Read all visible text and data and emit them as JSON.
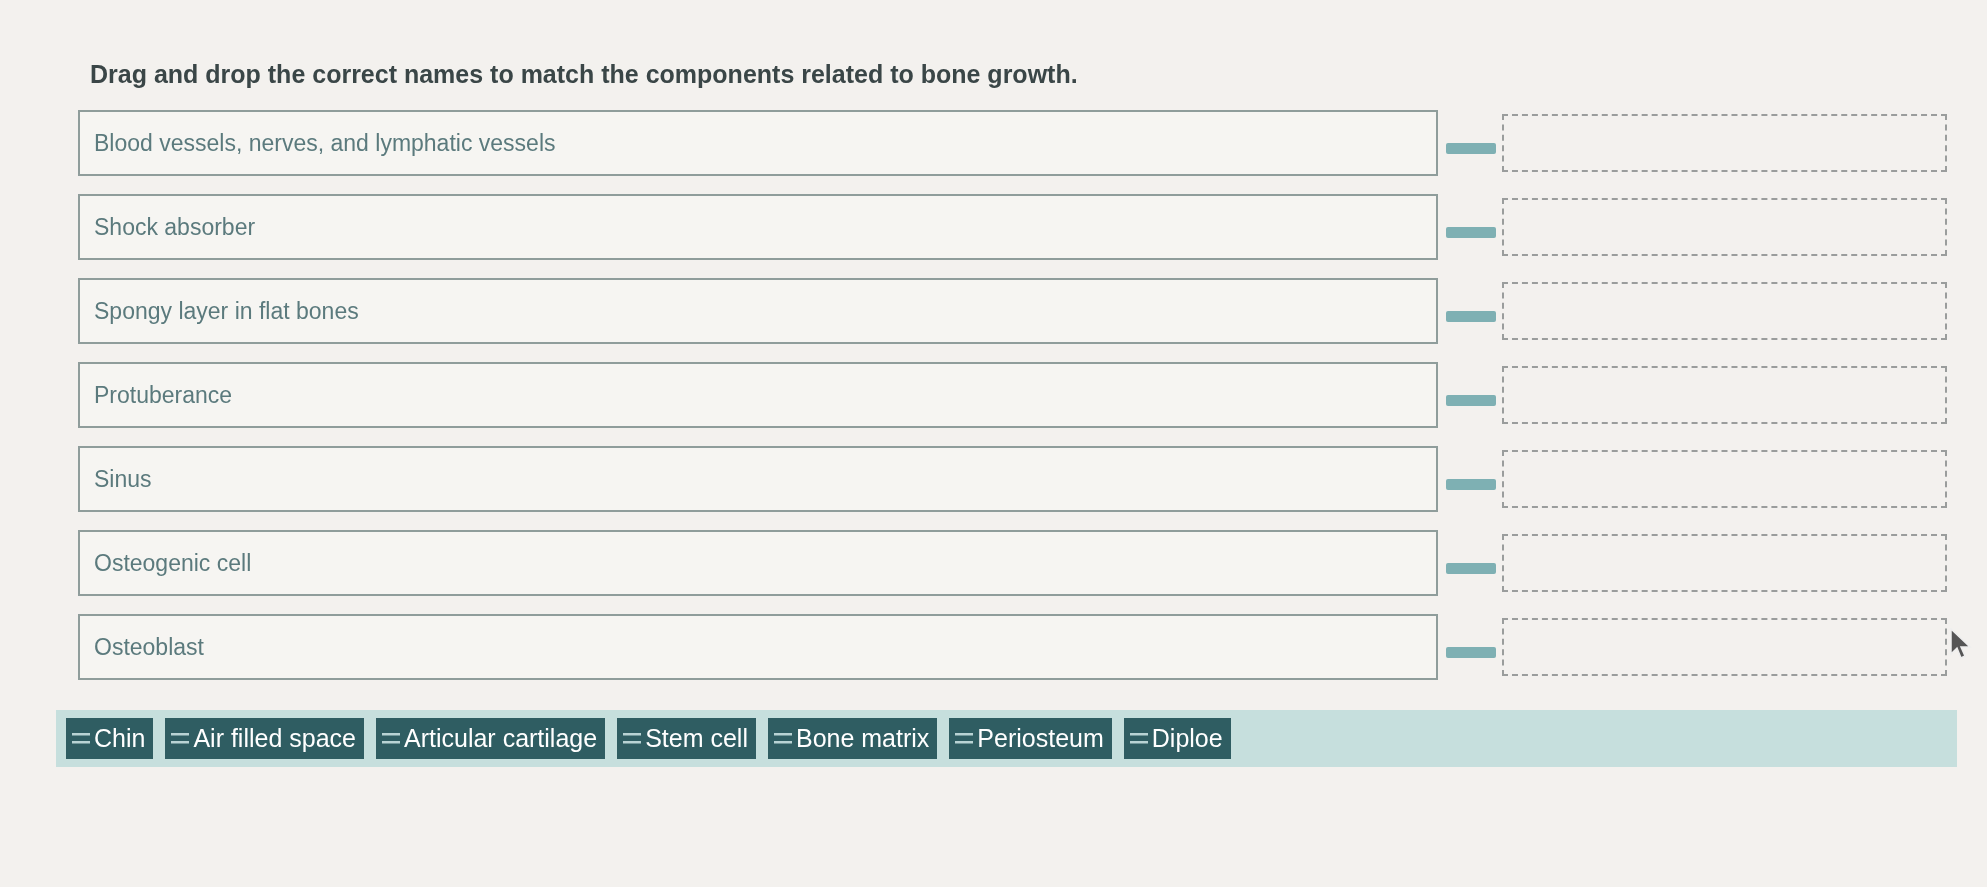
{
  "instruction": "Drag and drop the correct names to match the components related to bone growth.",
  "items": [
    {
      "label": "Blood vessels, nerves, and lymphatic vessels"
    },
    {
      "label": "Shock absorber"
    },
    {
      "label": "Spongy layer in flat bones"
    },
    {
      "label": "Protuberance"
    },
    {
      "label": "Sinus"
    },
    {
      "label": "Osteogenic cell"
    },
    {
      "label": "Osteoblast"
    }
  ],
  "word_bank": [
    {
      "label": "Chin"
    },
    {
      "label": "Air filled space"
    },
    {
      "label": "Articular cartilage"
    },
    {
      "label": "Stem cell"
    },
    {
      "label": "Bone matrix"
    },
    {
      "label": "Periosteum"
    },
    {
      "label": "Diploe"
    }
  ]
}
